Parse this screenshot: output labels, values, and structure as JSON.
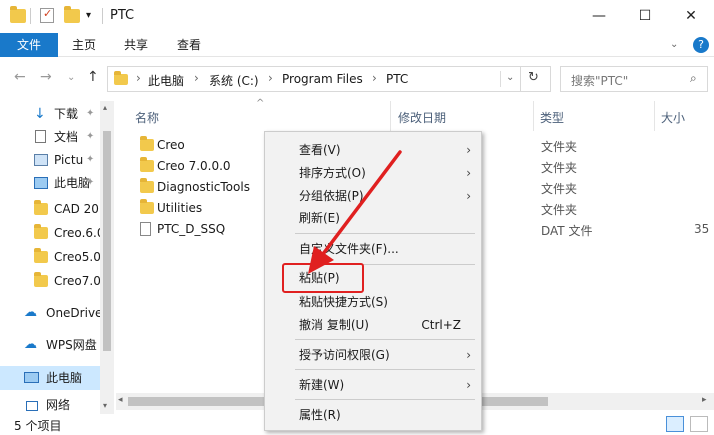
{
  "window": {
    "title": "PTC",
    "controls": {
      "minimize": "—",
      "maximize": "☐",
      "close": "✕"
    }
  },
  "ribbon": {
    "tabs": [
      "文件",
      "主页",
      "共享",
      "查看"
    ],
    "help": "?"
  },
  "address": {
    "crumbs": [
      "此电脑",
      "系统 (C:)",
      "Program Files",
      "PTC"
    ],
    "search_placeholder": "搜索\"PTC\""
  },
  "sidebar": {
    "items": [
      {
        "label": "下载",
        "icon": "download-arrow-icon",
        "pinned": true
      },
      {
        "label": "文档",
        "icon": "document-icon",
        "pinned": true
      },
      {
        "label": "Pictu",
        "icon": "pictures-icon",
        "pinned": true
      },
      {
        "label": "此电脑",
        "icon": "computer-icon",
        "pinned": true
      },
      {
        "label": "CAD 20",
        "icon": "folder-icon",
        "pinned": false
      },
      {
        "label": "Creo.6.0",
        "icon": "folder-icon",
        "pinned": false
      },
      {
        "label": "Creo5.0",
        "icon": "folder-icon",
        "pinned": false
      },
      {
        "label": "Creo7.0",
        "icon": "folder-icon",
        "pinned": false
      },
      {
        "label": "OneDrive",
        "icon": "cloud-icon",
        "pinned": false
      },
      {
        "label": "WPS网盘",
        "icon": "cloud-icon",
        "pinned": false
      },
      {
        "label": "此电脑",
        "icon": "computer-icon",
        "pinned": false
      },
      {
        "label": "网络",
        "icon": "network-icon",
        "pinned": false
      }
    ]
  },
  "columns": {
    "name": "名称",
    "modified": "修改日期",
    "type": "类型",
    "size": "大小"
  },
  "files": [
    {
      "name": "Creo",
      "type": "文件夹",
      "size": ""
    },
    {
      "name": "Creo 7.0.0.0",
      "type": "文件夹",
      "size": ""
    },
    {
      "name": "DiagnosticTools",
      "type": "文件夹",
      "size": ""
    },
    {
      "name": "Utilities",
      "type": "文件夹",
      "size": ""
    },
    {
      "name": "PTC_D_SSQ",
      "type": "DAT 文件",
      "size": "35"
    }
  ],
  "status": {
    "count": "5 个项目"
  },
  "context_menu": {
    "view": "查看(V)",
    "sort": "排序方式(O)",
    "group": "分组依据(P)",
    "refresh": "刷新(E)",
    "customize": "自定义文件夹(F)...",
    "paste": "粘贴(P)",
    "paste_shortcut": "粘贴快捷方式(S)",
    "undo": "撤消 复制(U)",
    "undo_shortcut": "Ctrl+Z",
    "grant_access": "授予访问权限(G)",
    "new": "新建(W)",
    "properties": "属性(R)"
  },
  "colors": {
    "accent": "#1979ca",
    "annotation": "#e02020",
    "folder": "#f2c94c"
  }
}
